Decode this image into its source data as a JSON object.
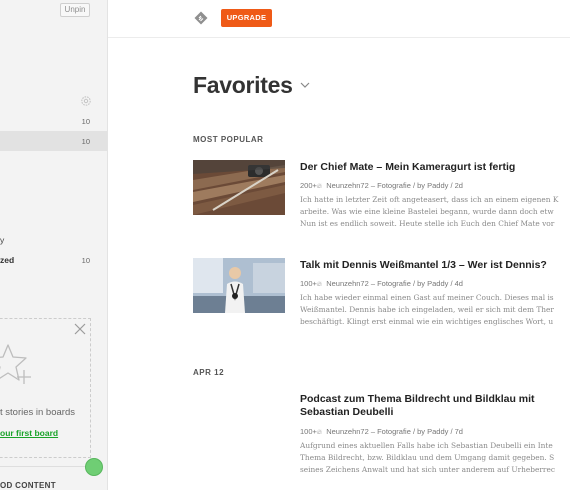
{
  "sidebar": {
    "unpin_label": "Unpin",
    "gear_icon": "gear-icon",
    "rows": [
      {
        "label": "",
        "count": "10"
      },
      {
        "label": "",
        "count": "10"
      },
      {
        "label": "y",
        "count": ""
      },
      {
        "label": "zed",
        "count": "10"
      }
    ],
    "boards_card": {
      "text": "t stories in boards",
      "link": "our first board",
      "icon": "star-plus-icon",
      "close_icon": "close-icon"
    },
    "section_label": "OD CONTENT"
  },
  "topbar": {
    "logo_icon": "feedly-logo-icon",
    "upgrade_label": "UPGRADE",
    "upgrade_color": "#ef5a17"
  },
  "main": {
    "title": "Favorites",
    "sections": [
      {
        "header": "MOST POPULAR"
      },
      {
        "header": "APR 12"
      }
    ],
    "articles": [
      {
        "title": "Der Chief Mate – Mein Kameragurt ist fertig",
        "count": "200+",
        "meta": "Neunzehn72 – Fotografie / by Paddy / 2d",
        "excerpt": [
          "Ich hatte in letzter Zeit oft angeteasert, dass ich an einem eigenen K",
          "arbeite. Was wie eine kleine Bastelei begann, wurde dann doch etw",
          "Nun ist es endlich soweit. Heute stelle ich Euch den Chief Mate vor"
        ]
      },
      {
        "title": "Talk mit Dennis Weißmantel 1/3 – Wer ist Dennis?",
        "count": "100+",
        "meta": "Neunzehn72 – Fotografie / by Paddy / 4d",
        "excerpt": [
          "Ich habe wieder einmal einen Gast auf meiner Couch. Dieses mal is",
          "Weißmantel. Dennis habe ich eingeladen, weil er sich mit dem Ther",
          "beschäftigt. Klingt erst einmal wie ein wichtiges englisches Wort, u"
        ]
      },
      {
        "title": "Podcast zum Thema Bildrecht und Bildklau mit Sebastian Deubelli",
        "count": "100+",
        "meta": "Neunzehn72 – Fotografie / by Paddy / 7d",
        "excerpt": [
          "Aufgrund eines aktuellen Falls habe ich Sebastian Deubelli ein Inte",
          "Thema Bildrecht, bzw. Bildklau und dem Umgang damit gegeben. S",
          "seines Zeichens Anwalt und hat sich unter anderem auf Urheberrec"
        ]
      }
    ]
  }
}
